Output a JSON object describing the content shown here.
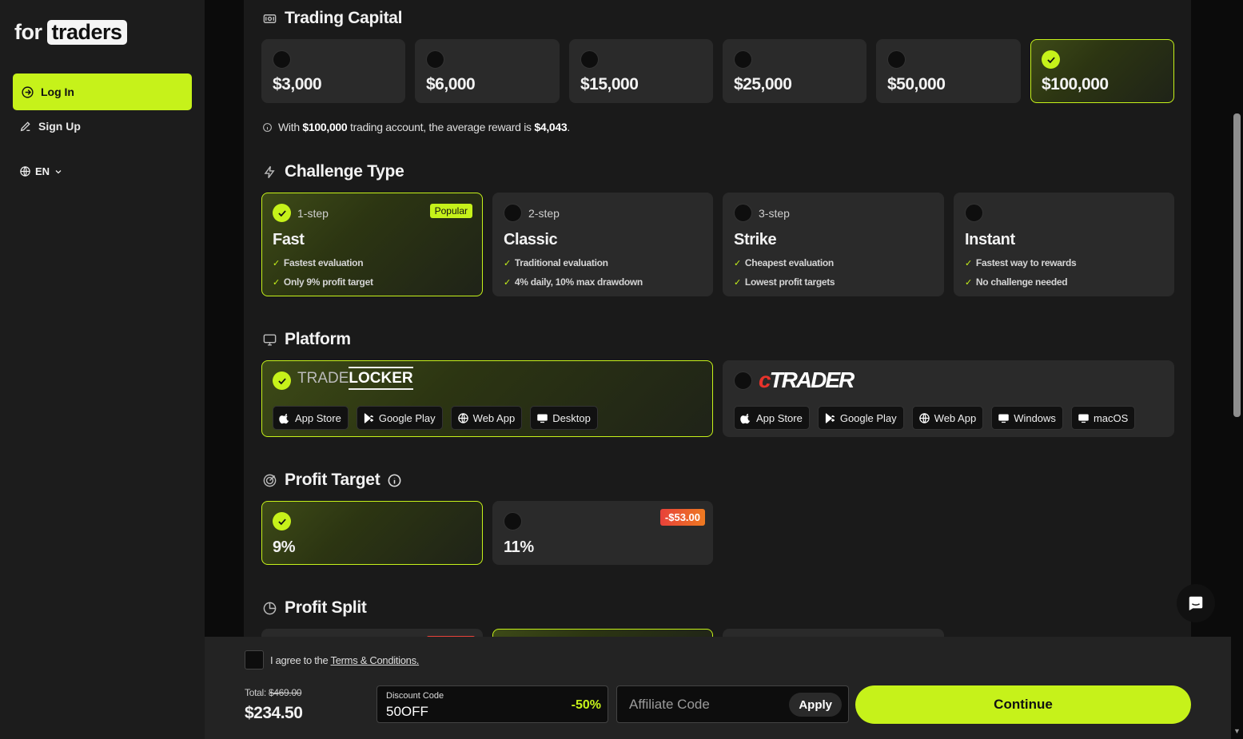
{
  "sidebar": {
    "logo_word1": "for",
    "logo_word2": "traders",
    "login_label": "Log In",
    "signup_label": "Sign Up",
    "lang_label": "EN"
  },
  "capital": {
    "title": "Trading Capital",
    "options": [
      "$3,000",
      "$6,000",
      "$15,000",
      "$25,000",
      "$50,000",
      "$100,000"
    ],
    "selected_index": 5,
    "info_prefix": "With",
    "info_account": "$100,000",
    "info_middle": "trading account, the average reward is",
    "info_reward": "$4,043",
    "info_suffix": "."
  },
  "challenge": {
    "title": "Challenge Type",
    "popular_label": "Popular",
    "options": [
      {
        "step": "1-step",
        "name": "Fast",
        "features": [
          "Fastest evaluation",
          "Only 9% profit target"
        ]
      },
      {
        "step": "2-step",
        "name": "Classic",
        "features": [
          "Traditional evaluation",
          "4% daily, 10% max drawdown"
        ]
      },
      {
        "step": "3-step",
        "name": "Strike",
        "features": [
          "Cheapest evaluation",
          "Lowest profit targets"
        ]
      },
      {
        "step": "",
        "name": "Instant",
        "features": [
          "Fastest way to rewards",
          "No challenge needed"
        ]
      }
    ]
  },
  "platform": {
    "title": "Platform",
    "tradelocker": {
      "logo_a": "TRADE",
      "logo_b": "LOCKER",
      "pills": [
        "App Store",
        "Google Play",
        "Web App",
        "Desktop"
      ]
    },
    "ctrader": {
      "logo_c": "c",
      "logo_rest": "TRADER",
      "pills": [
        "App Store",
        "Google Play",
        "Web App",
        "Windows",
        "macOS"
      ]
    }
  },
  "profit_target": {
    "title": "Profit Target",
    "options": [
      "9%",
      "11%"
    ],
    "discount_badge": "-$53.00"
  },
  "profit_split": {
    "title": "Profit Split"
  },
  "footer": {
    "agree_text": "I agree to the",
    "terms_link": "Terms & Conditions.",
    "total_label": "Total:",
    "total_old": "$469.00",
    "total_price": "$234.50",
    "discount_label": "Discount Code",
    "discount_value": "50OFF",
    "discount_pct": "-50%",
    "affiliate_placeholder": "Affiliate Code",
    "apply_label": "Apply",
    "continue_label": "Continue"
  },
  "colors": {
    "accent": "#c6f21a",
    "background": "#1a1a1a",
    "card": "#2a2a2a"
  }
}
